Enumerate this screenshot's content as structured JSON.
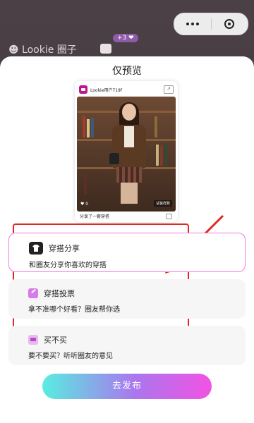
{
  "background": {
    "circle_title": "☻ Lookie 圈子",
    "badge": "+3 ❤"
  },
  "sheet": {
    "title": "仅预览"
  },
  "preview_card": {
    "user_name": "Lookie用户719f",
    "caption": "分享了一套穿搭",
    "like_label": "♥ 0",
    "watermark": "试装样数"
  },
  "options": [
    {
      "icon": "shirt-icon",
      "title": "穿搭分享",
      "description": "和圈友分享你喜欢的穿搭",
      "selected": true
    },
    {
      "icon": "vote-icon",
      "title": "穿搭投票",
      "description": "拿不准哪个好看？圈友帮你选",
      "selected": false
    },
    {
      "icon": "cart-icon",
      "title": "买不买",
      "description": "要不要买？听听圈友的意见",
      "selected": false
    }
  ],
  "publish_button": "去发布",
  "colors": {
    "selected_border": "#f07de0",
    "annotation_red": "#e02a1f",
    "button_gradient": [
      "#58ede0",
      "#ab76ee",
      "#f253e3"
    ]
  }
}
